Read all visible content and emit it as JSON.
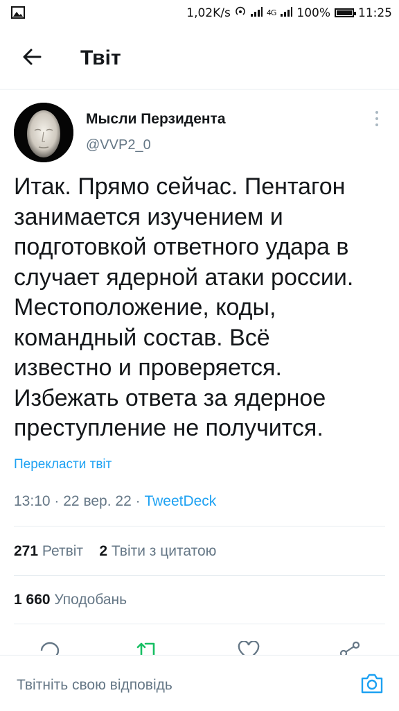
{
  "status": {
    "speed": "1,02K/s",
    "network": "4G",
    "battery": "100%",
    "time": "11:25"
  },
  "header": {
    "title": "Твіт"
  },
  "author": {
    "name": "Мысли Перзидента",
    "handle": "@VVP2_0"
  },
  "tweet": {
    "text": "Итак. Прямо сейчас. Пентагон\nзанимается изучением и\nподготовкой ответного удара в\nслучает ядерной атаки россии.\nМестоположение, коды,\nкомандный состав. Всё\nизвестно и проверяется.\nИзбежать ответа за ядерное\nпреступление не получится.",
    "translate": "Перекласти твіт",
    "time": "13:10",
    "date": "22 вер. 22",
    "separator": "·",
    "source": "TweetDeck"
  },
  "stats": {
    "retweets_count": "271",
    "retweets_label": "Ретвіт",
    "quotes_count": "2",
    "quotes_label": "Твіти з цитатою",
    "likes_count": "1 660",
    "likes_label": "Уподобань"
  },
  "reply": {
    "placeholder": "Твітніть свою відповідь"
  },
  "colors": {
    "accent": "#1da1f2",
    "retweet": "#17bf63",
    "secondary": "#657786",
    "divider": "#e6ecf0"
  }
}
